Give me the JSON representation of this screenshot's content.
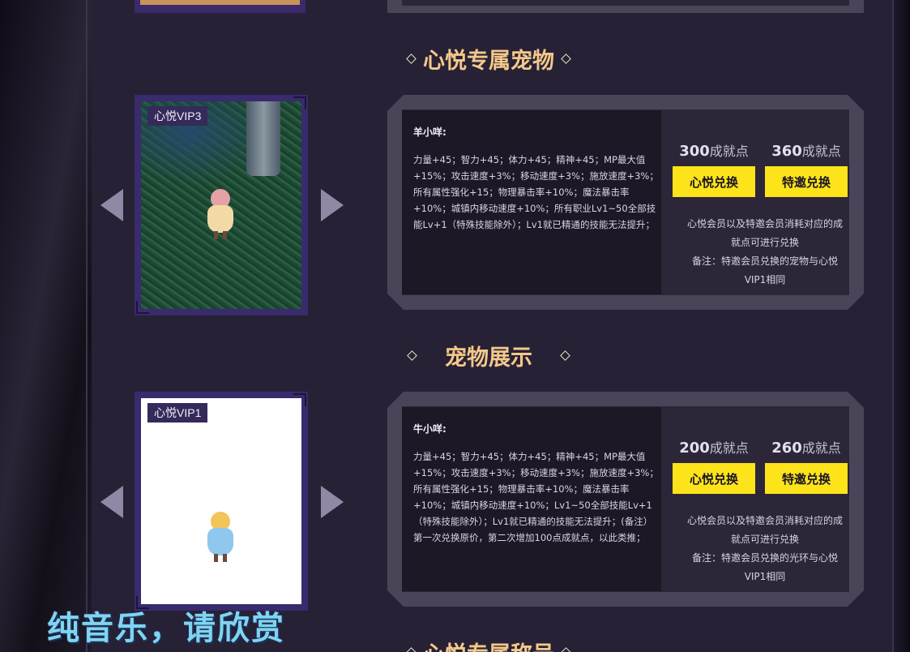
{
  "sections": {
    "exclusive_pet_title": "心悦专属宠物",
    "pet_display_title": "宠物展示",
    "exclusive_title_title": "心悦专属称号"
  },
  "pet1": {
    "vip_tag": "心悦VIP3",
    "name": "羊小咩:",
    "attrs": "力量+45；智力+45；体力+45；精神+45；MP最大值+15%；攻击速度+3%；移动速度+3%；施放速度+3%；所有属性强化+15；物理暴击率+10%；魔法暴击率+10%；城镇内移动速度+10%；所有职业Lv1~50全部技能Lv+1（特殊技能除外）；Lv1就已精通的技能无法提升；",
    "cost_a_num": "300",
    "cost_a_unit": "成就点",
    "cost_b_num": "360",
    "cost_b_unit": "成就点",
    "btn_a": "心悦兑换",
    "btn_b": "特邀兑换",
    "note1": "心悦会员以及特邀会员消耗对应的成就点可进行兑换",
    "note2": "备注：特邀会员兑换的宠物与心悦VIP1相同"
  },
  "pet2": {
    "vip_tag": "心悦VIP1",
    "name": "牛小咩:",
    "attrs": "力量+45；智力+45；体力+45；精神+45；MP最大值+15%；攻击速度+3%；移动速度+3%；施放速度+3%；所有属性强化+15；物理暴击率+10%；魔法暴击率+10%；城镇内移动速度+10%；Lv1~50全部技能Lv+1（特殊技能除外）；Lv1就已精通的技能无法提升；(备注）第一次兑换原价，第二次增加100点成就点，以此类推；",
    "cost_a_num": "200",
    "cost_a_unit": "成就点",
    "cost_b_num": "260",
    "cost_b_unit": "成就点",
    "btn_a": "心悦兑换",
    "btn_b": "特邀兑换",
    "note1": "心悦会员以及特邀会员消耗对应的成就点可进行兑换",
    "note2": "备注：特邀会员兑换的光环与心悦VIP1相同"
  },
  "banner": "纯音乐，请欣赏",
  "icons": {
    "prev": "arrow-left-icon",
    "next": "arrow-right-icon",
    "title_ornament": "diamond-icon"
  },
  "colors": {
    "accent_yellow": "#fde31a",
    "title_gold": "#f3c88a",
    "panel": "#4a4458"
  }
}
